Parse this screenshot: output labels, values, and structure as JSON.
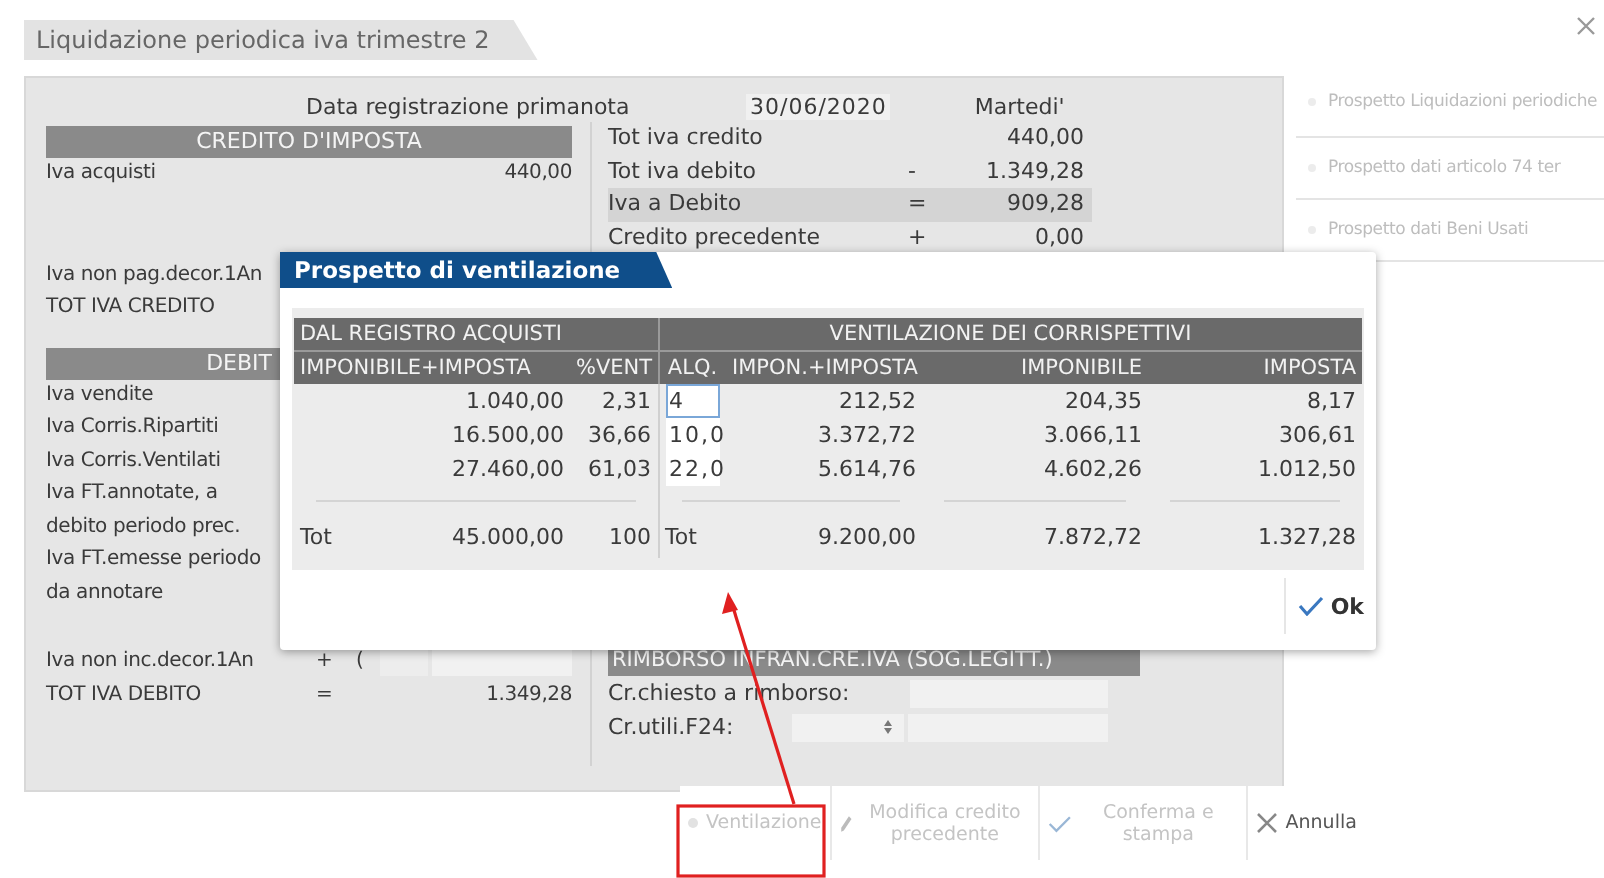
{
  "tab": {
    "title": "Liquidazione periodica iva trimestre 2"
  },
  "registration": {
    "label": "Data registrazione primanota",
    "date": "30/06/2020",
    "weekday": "Martedi'"
  },
  "left_panel": {
    "credit_header": "CREDITO D'IMPOSTA",
    "credit_rows": [
      {
        "label": "Iva acquisti",
        "value": "440,00"
      }
    ],
    "non_paid_label": "Iva non pag.decor.1An",
    "tot_credit_label": "TOT IVA CREDITO",
    "debit_header": "DEBIT",
    "debit_rows": [
      "Iva vendite",
      "Iva Corris.Ripartiti",
      "Iva Corris.Ventilati",
      "Iva FT.annotate, a\ndebito periodo prec.",
      "Iva FT.emesse periodo\nda annotare"
    ],
    "non_included": {
      "label": "Iva non inc.decor.1An",
      "sign": "+",
      "paren": "("
    },
    "tot_debit": {
      "label": "TOT IVA DEBITO",
      "sign": "=",
      "value": "1.349,28"
    }
  },
  "summary": {
    "rows": [
      {
        "label": "Tot iva credito",
        "sign": "",
        "value": "440,00",
        "highlighted": false
      },
      {
        "label": "Tot iva debito",
        "sign": "-",
        "value": "1.349,28",
        "highlighted": false
      },
      {
        "label": "Iva a Debito",
        "sign": "=",
        "value": "909,28",
        "highlighted": true
      },
      {
        "label": "Credito precedente",
        "sign": "+",
        "value": "0,00",
        "highlighted": false
      }
    ]
  },
  "refund": {
    "header": "RIMBORSO INFRAN.CRE.IVA (SOG.LEGITT.)",
    "requested_label": "Cr.chiesto a rimborso:",
    "usable_label": "Cr.utili.F24:"
  },
  "sidebar": {
    "items": [
      {
        "label": "Prospetto Liquidazioni periodiche",
        "disabled": true
      },
      {
        "label": "Prospetto dati articolo 74 ter",
        "disabled": true
      },
      {
        "label": "Prospetto dati Beni Usati",
        "disabled": true
      }
    ]
  },
  "toolbar": {
    "buttons": [
      {
        "label": "Ventilazione",
        "kind": "dot",
        "disabled": true
      },
      {
        "label": "Modifica credito precedente",
        "kind": "pencil",
        "disabled": true
      },
      {
        "label": "Conferma e stampa",
        "kind": "check",
        "disabled": true
      },
      {
        "label": "Annulla",
        "kind": "cross",
        "disabled": false
      }
    ]
  },
  "modal": {
    "title": "Prospetto di ventilazione",
    "group_headers": [
      "DAL REGISTRO ACQUISTI",
      "VENTILAZIONE DEI CORRISPETTIVI"
    ],
    "columns": [
      "IMPONIBILE+IMPOSTA",
      "%VENT",
      "ALQ.",
      "IMPON.+IMPOSTA",
      "IMPONIBILE",
      "IMPOSTA"
    ],
    "rows": [
      {
        "amount": "1.040,00",
        "percent": "2,31",
        "rate": "4",
        "focused": true,
        "gross": "212,52",
        "net": "204,35",
        "tax": "8,17"
      },
      {
        "amount": "16.500,00",
        "percent": "36,66",
        "rate": "10,0",
        "focused": false,
        "gross": "3.372,72",
        "net": "3.066,11",
        "tax": "306,61"
      },
      {
        "amount": "27.460,00",
        "percent": "61,03",
        "rate": "22,0",
        "focused": false,
        "gross": "5.614,76",
        "net": "4.602,26",
        "tax": "1.012,50"
      }
    ],
    "total": {
      "label": "Tot",
      "amount": "45.000,00",
      "percent": "100",
      "label2": "Tot",
      "gross": "9.200,00",
      "net": "7.872,72",
      "tax": "1.327,28"
    },
    "ok_label": "Ok"
  }
}
